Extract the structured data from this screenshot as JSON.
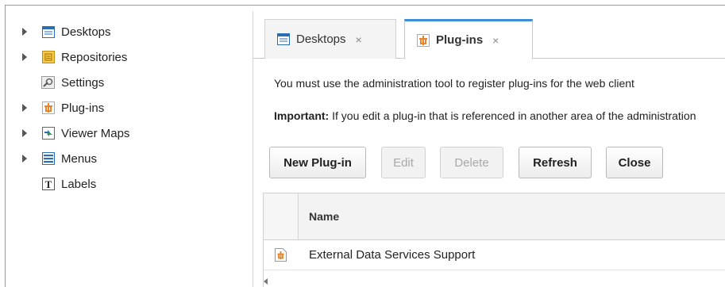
{
  "sidebar": {
    "items": [
      {
        "label": "Desktops",
        "icon": "desktop-icon",
        "expandable": true
      },
      {
        "label": "Repositories",
        "icon": "repository-icon",
        "expandable": true
      },
      {
        "label": "Settings",
        "icon": "settings-icon",
        "expandable": false
      },
      {
        "label": "Plug-ins",
        "icon": "plugin-icon",
        "expandable": true
      },
      {
        "label": "Viewer Maps",
        "icon": "viewer-map-icon",
        "expandable": true
      },
      {
        "label": "Menus",
        "icon": "menu-icon",
        "expandable": true
      },
      {
        "label": "Labels",
        "icon": "label-icon",
        "expandable": false
      }
    ]
  },
  "tabs": [
    {
      "label": "Desktops",
      "close": "×",
      "active": false
    },
    {
      "label": "Plug-ins",
      "close": "×",
      "active": true
    }
  ],
  "messages": {
    "line1": "You must use the administration tool to register plug-ins for the web client",
    "line2_strong": "Important:",
    "line2_rest": " If you edit a plug-in that is referenced in another area of the administration"
  },
  "toolbar": {
    "new_plugin": "New Plug-in",
    "edit": "Edit",
    "delete": "Delete",
    "refresh": "Refresh",
    "close": "Close"
  },
  "grid": {
    "columns": [
      "Name"
    ],
    "rows": [
      {
        "name": "External Data Services Support",
        "icon": "plugin-icon"
      }
    ]
  },
  "colors": {
    "accent": "#3a8fd6",
    "plugin_orange": "#e8832a",
    "desktop_blue": "#2a6db0"
  }
}
